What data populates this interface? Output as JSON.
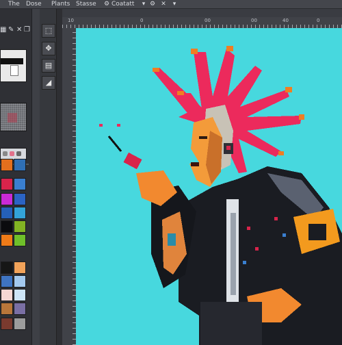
{
  "menubar": {
    "items": [
      "The",
      "Dose",
      "Plants",
      "Stasse",
      "Coatatt"
    ]
  },
  "ruler": {
    "labels": [
      "10",
      "0",
      "00",
      "00",
      "40",
      "0"
    ]
  },
  "colors": {
    "canvas_bg": "#47d8de",
    "palette": [
      "#e36f1d",
      "#2f6fb5",
      "#d8244b",
      "#3a7fd0",
      "#c92ad6",
      "#2b63c4",
      "#2560b8",
      "#33a3d8",
      "#0b0b0e",
      "#82b323",
      "#ef7b18",
      "#6fbf2a",
      "#161616",
      "#f2a35a",
      "#3f74c2",
      "#a4c9ef",
      "#f6d7d3",
      "#cde4f6",
      "#b9763a",
      "#7a6fa4",
      "#7a3a2e",
      "#9c9c9c"
    ]
  },
  "tools": [
    "select-tool",
    "move-tool",
    "layer-tool",
    "shape-tool"
  ]
}
